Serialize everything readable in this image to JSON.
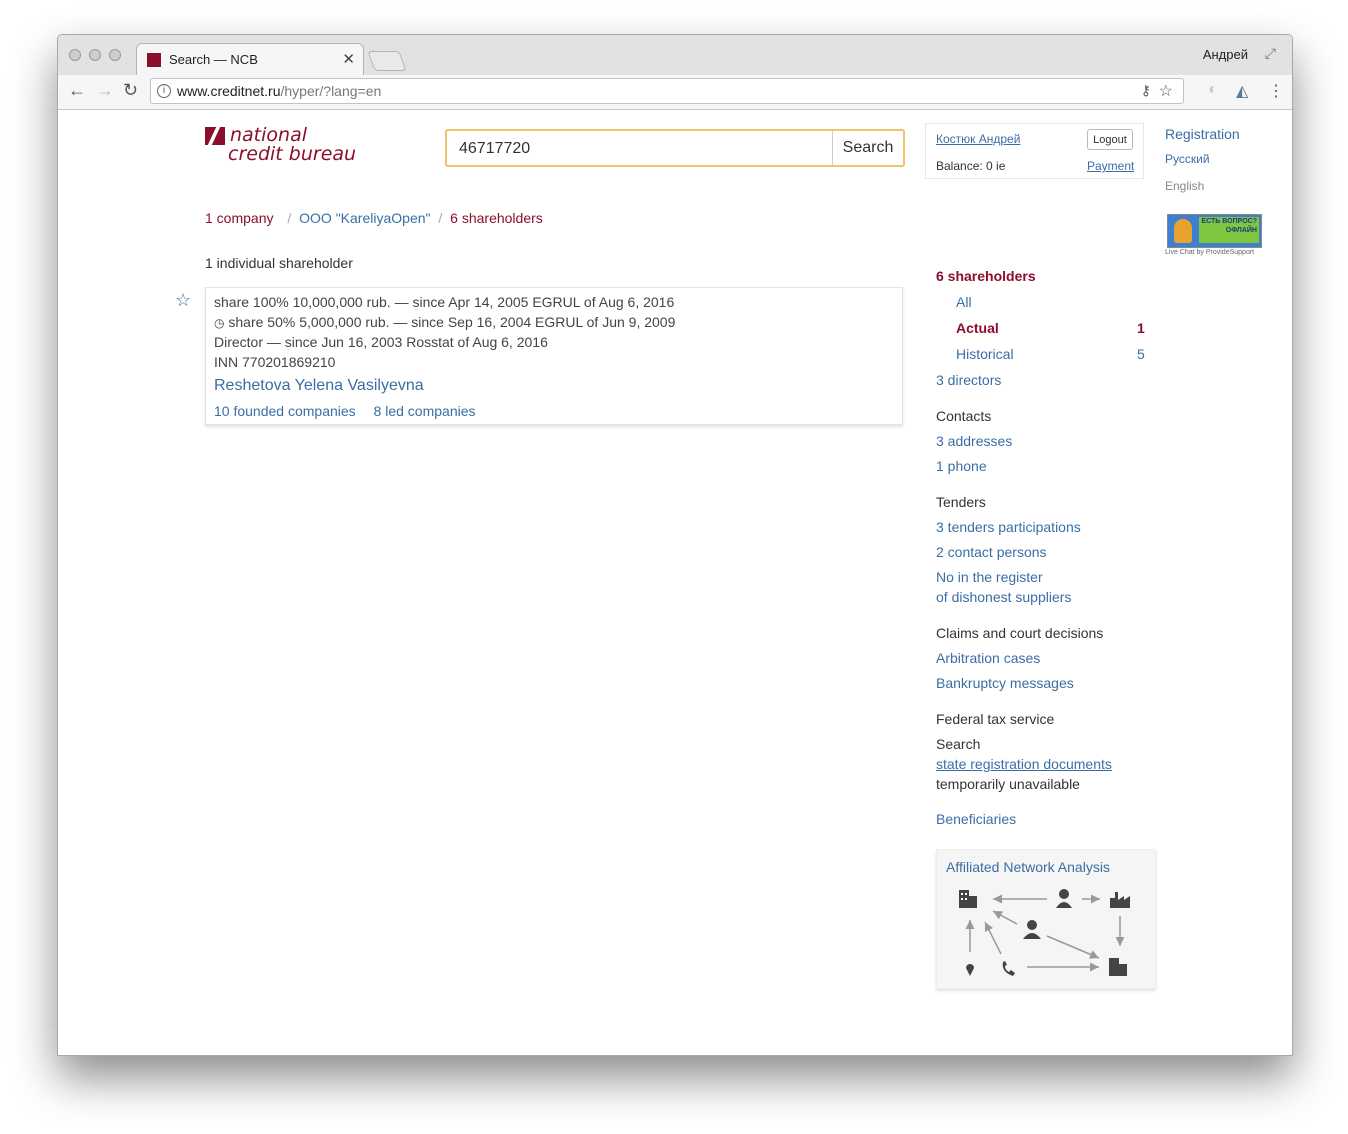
{
  "browser": {
    "tab_title": "Search — NCB",
    "user": "Андрей",
    "url_host": "www.creditnet.ru",
    "url_path": "/hyper/?lang=en"
  },
  "header": {
    "logo_line1": "national",
    "logo_line2": "credit bureau",
    "search_value": "46717720",
    "search_button": "Search",
    "account_name": "Костюк Андрей",
    "logout": "Logout",
    "balance": "Balance: 0 ie",
    "payment": "Payment",
    "registration": "Registration",
    "lang_ru": "Русский",
    "lang_en": "English",
    "livechat_badge": "ЕСТЬ ВОПРОС? ОФЛАЙН",
    "livechat_caption": "Live Chat by ProvideSupport"
  },
  "breadcrumb": {
    "item1": "1 company",
    "item2": "OOO \"KareliyaOpen\"",
    "item3": "6 shareholders",
    "sep": "/"
  },
  "main": {
    "section_heading": "1 individual shareholder",
    "card": {
      "line1": "share 100%  10,000,000 rub. — since Apr 14, 2005 EGRUL of Aug 6, 2016",
      "line2": "share 50%  5,000,000 rub. — since Sep 16, 2004 EGRUL of Jun 9, 2009",
      "line3": "Director — since Jun 16, 2003 Rosstat of Aug 6, 2016",
      "line4": "INN 770201869210",
      "name": "Reshetova Yelena Vasilyevna",
      "founded": "10 founded companies",
      "led": "8 led companies"
    }
  },
  "sidebar": {
    "shareholders": "6 shareholders",
    "all": "All",
    "actual": "Actual",
    "actual_count": "1",
    "historical": "Historical",
    "historical_count": "5",
    "directors": "3 directors",
    "contacts": "Contacts",
    "addresses": "3 addresses",
    "phone": "1 phone",
    "tenders": "Tenders",
    "tenders_part": "3 tenders participations",
    "contact_persons": "2 contact persons",
    "register1": "No in the register",
    "register2": "of dishonest suppliers",
    "claims": "Claims and court decisions",
    "arbitration": "Arbitration cases",
    "bankruptcy": "Bankruptcy messages",
    "fts": "Federal tax service",
    "fts_search": "Search",
    "fts_docs": "state registration documents",
    "fts_unavail": "temporarily unavailable",
    "beneficiaries": "Beneficiaries",
    "network_title": "Affiliated Network Analysis"
  }
}
